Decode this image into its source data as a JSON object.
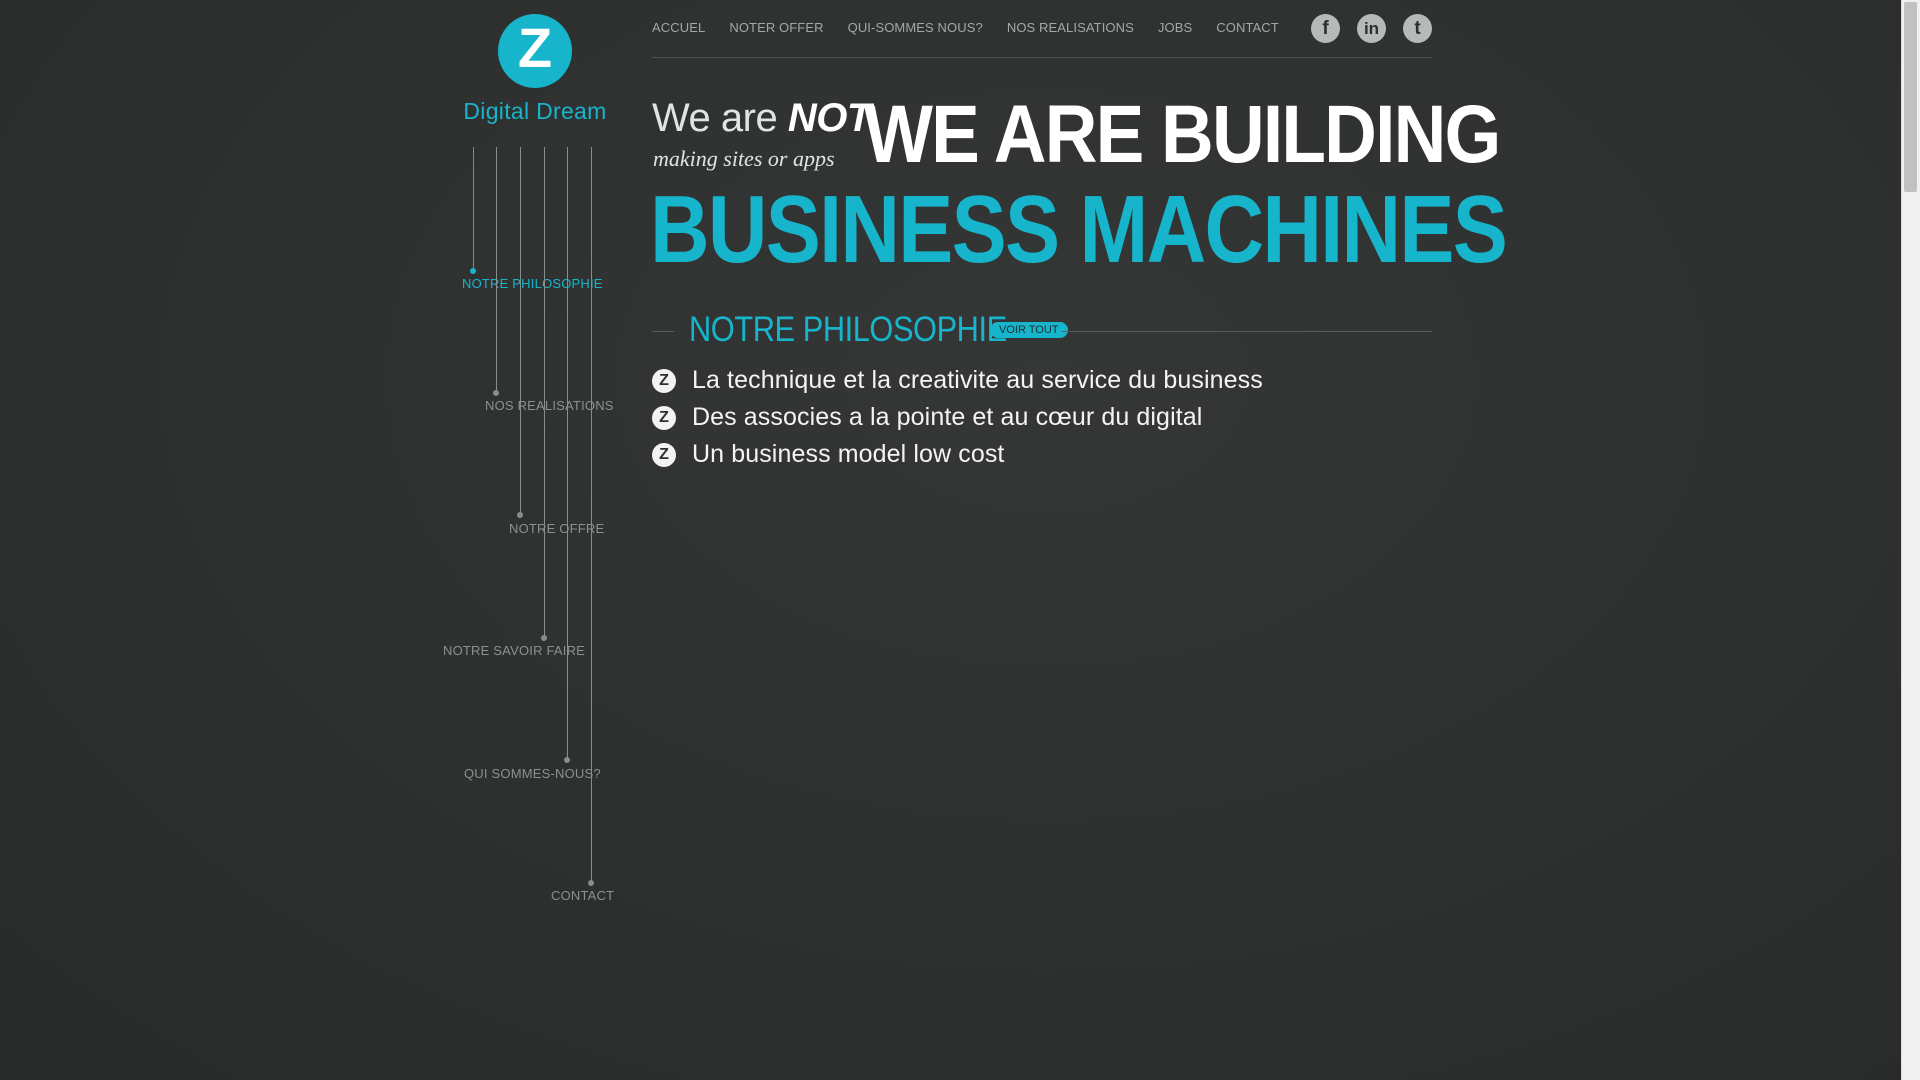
{
  "brand": {
    "logo_letter": "Z",
    "name": "Digital Dream"
  },
  "top_nav": [
    "ACCUEL",
    "NOTER OFFER",
    "QUI-SOMMES NOUS?",
    "NOS REALISATIONS",
    "JOBS",
    "CONTACT"
  ],
  "social": {
    "facebook": {
      "label": "f",
      "icon": "facebook-icon"
    },
    "linkedin": {
      "label": "in",
      "icon": "linkedin-icon"
    },
    "twitter": {
      "label": "t",
      "icon": "twitter-icon"
    }
  },
  "side_nav": [
    {
      "label": "NOTRE PHILOSOPHIE",
      "active": true
    },
    {
      "label": "NOS REALISATIONS",
      "active": false
    },
    {
      "label": "NOTRE OFFRE",
      "active": false
    },
    {
      "label": "NOTRE SAVOIR FAIRE",
      "active": false
    },
    {
      "label": "QUI SOMMES-NOUS?",
      "active": false
    },
    {
      "label": "CONTACT",
      "active": false
    }
  ],
  "hero": {
    "we_are": "We are",
    "not": "NOT",
    "making": "making sites or apps",
    "line1": "WE ARE BUILDING",
    "line2": "BUSINESS MACHINES"
  },
  "section": {
    "title": "NOTRE PHILOSOPHIE",
    "voir_tout": "VOIR TOUT",
    "bullet_icon": "Z",
    "bullets": [
      "La technique et la creativite au service du business",
      "Des associes a la pointe et au cœur du digital",
      "Un business model low cost"
    ]
  },
  "colors": {
    "accent": "#17b5cb",
    "background": "#2d2f2f",
    "muted_text": "#8c9090"
  }
}
